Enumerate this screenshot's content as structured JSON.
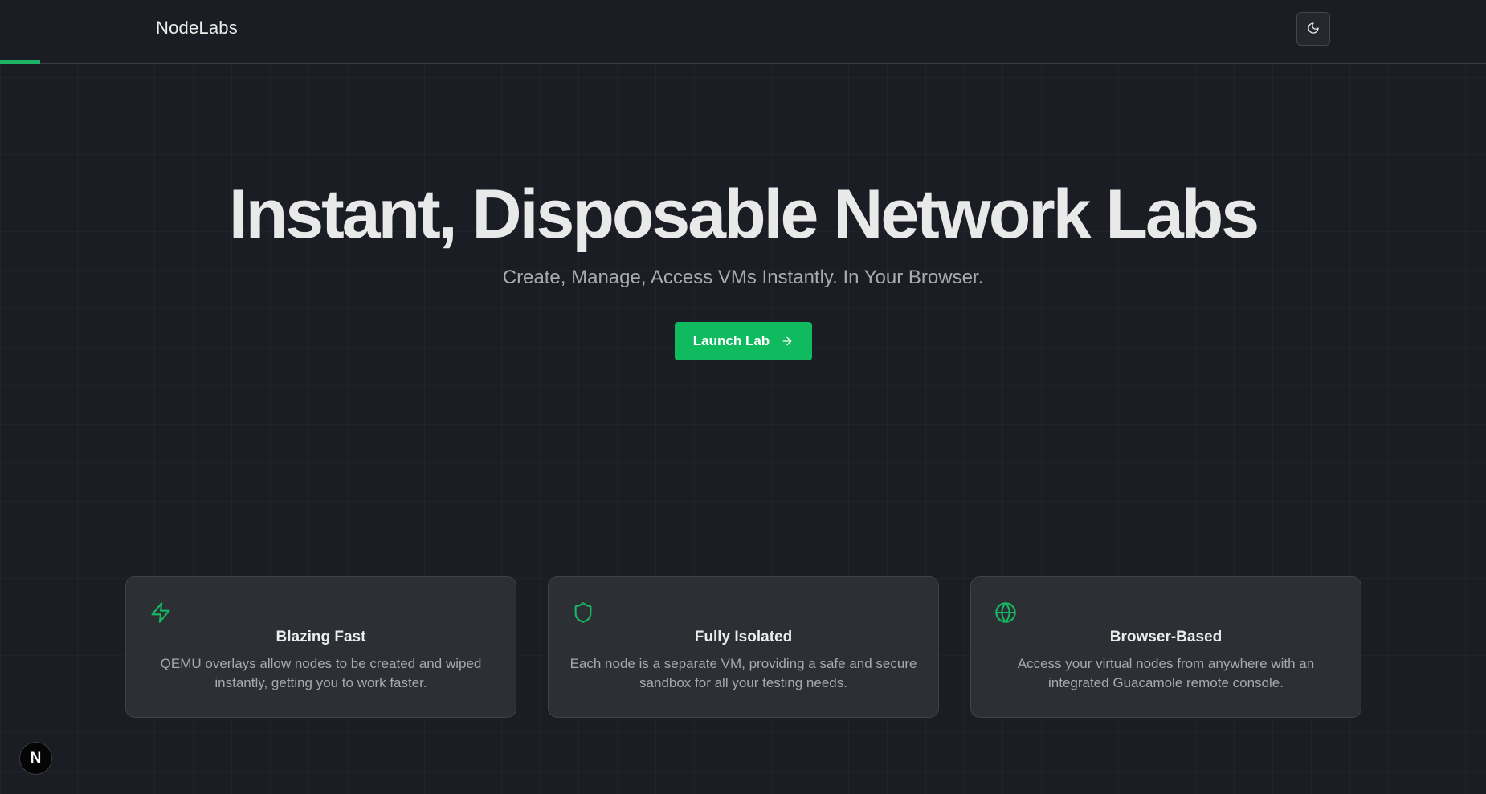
{
  "header": {
    "brand": "NodeLabs",
    "theme_toggle_icon": "moon-icon",
    "progress_fraction": 0.027
  },
  "hero": {
    "title": "Instant, Disposable Network Labs",
    "subtitle": "Create, Manage, Access VMs Instantly. In Your Browser.",
    "cta_label": "Launch Lab",
    "cta_icon": "arrow-right-icon"
  },
  "features": [
    {
      "icon": "zap-icon",
      "title": "Blazing Fast",
      "description": "QEMU overlays allow nodes to be created and wiped instantly, getting you to work faster."
    },
    {
      "icon": "shield-icon",
      "title": "Fully Isolated",
      "description": "Each node is a separate VM, providing a safe and secure sandbox for all your testing needs."
    },
    {
      "icon": "globe-icon",
      "title": "Browser-Based",
      "description": "Access your virtual nodes from anywhere with an integrated Guacamole remote console."
    }
  ],
  "badge": {
    "label": "N",
    "icon": "nextjs-logo-icon"
  },
  "colors": {
    "accent": "#0fbb5e",
    "background": "#1b1d24",
    "card": "#2c2f33"
  }
}
